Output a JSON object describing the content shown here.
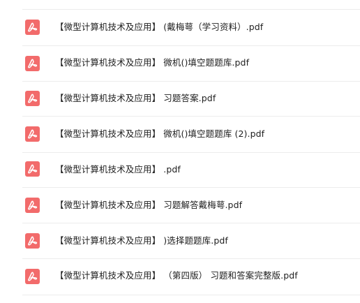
{
  "files": [
    {
      "name": "【微型计算机技术及应用】 (戴梅萼（学习资料）.pdf",
      "icon": "pdf-icon"
    },
    {
      "name": "【微型计算机技术及应用】 微机()填空题题库.pdf",
      "icon": "pdf-icon"
    },
    {
      "name": "【微型计算机技术及应用】 习题答案.pdf",
      "icon": "pdf-icon"
    },
    {
      "name": "【微型计算机技术及应用】 微机()填空题题库 (2).pdf",
      "icon": "pdf-icon"
    },
    {
      "name": "【微型计算机技术及应用】 .pdf",
      "icon": "pdf-icon"
    },
    {
      "name": "【微型计算机技术及应用】 习题解答戴梅萼.pdf",
      "icon": "pdf-icon"
    },
    {
      "name": "【微型计算机技术及应用】 )选择题题库.pdf",
      "icon": "pdf-icon"
    },
    {
      "name": "【微型计算机技术及应用】 （第四版） 习题和答案完整版.pdf",
      "icon": "pdf-icon"
    }
  ],
  "colors": {
    "pdf_icon": "#f26b6b",
    "divider": "#ececec",
    "text": "#202020"
  }
}
